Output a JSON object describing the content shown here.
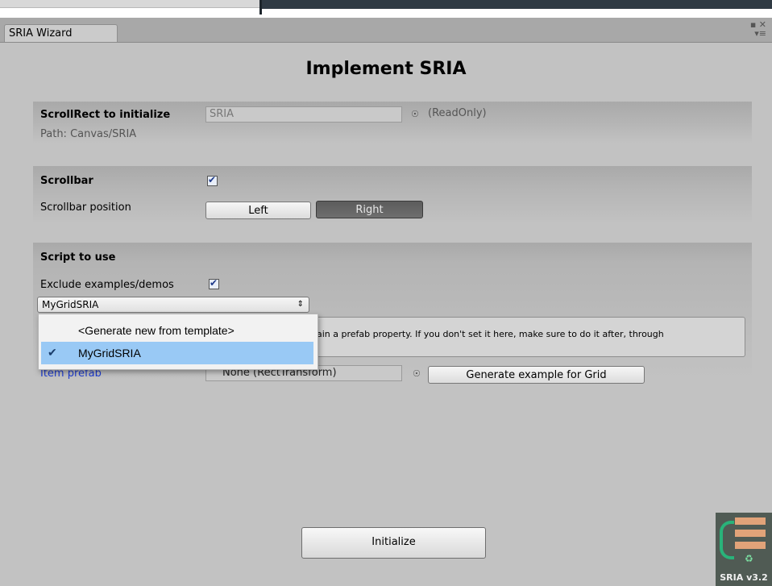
{
  "window": {
    "tab_label": "SRIA Wizard",
    "controls": "▪ ✕\n▾≡"
  },
  "title": "Implement SRIA",
  "scrollrect_section": {
    "label": "ScrollRect to initialize",
    "field_value": "SRIA",
    "readonly_label": "(ReadOnly)",
    "path_label": "Path: Canvas/SRIA"
  },
  "scrollbar_section": {
    "label": "Scrollbar",
    "checked": true,
    "position_label": "Scrollbar position",
    "left_button": "Left",
    "right_button": "Right",
    "selected": "Right"
  },
  "script_section": {
    "label": "Script to use",
    "exclude_label": "Exclude examples/demos",
    "exclude_checked": true,
    "selected_script": "MyGridSRIA",
    "dropdown_options": [
      {
        "label": "<Generate new from template>",
        "selected": false
      },
      {
        "label": "MyGridSRIA",
        "selected": true
      }
    ],
    "help_text": "ain a prefab property. If you don't set it here, make sure to do it after, through",
    "item_prefab_label": "Item prefab",
    "item_prefab_value": "None (RectTransform)",
    "generate_button": "Generate example for Grid"
  },
  "initialize_button": "Initialize",
  "logo": {
    "version": "SRIA v3.2",
    "colors": {
      "bars": "#e1a379",
      "curve": "#29b37a",
      "background": "#505b54"
    }
  }
}
